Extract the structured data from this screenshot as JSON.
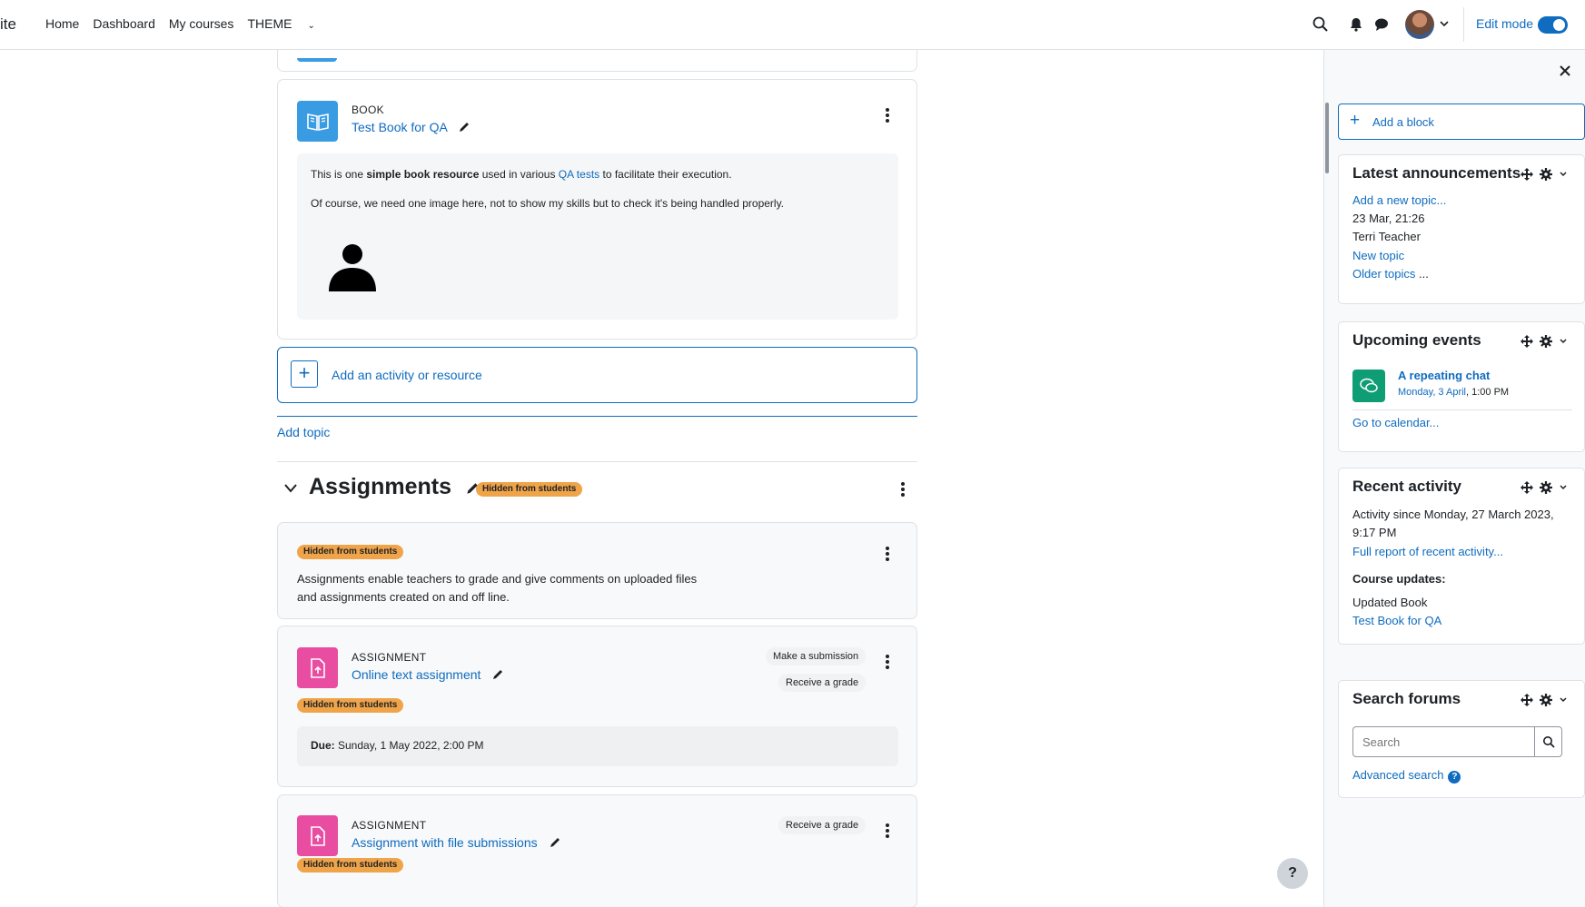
{
  "navbar": {
    "site_name": "ite",
    "links": [
      "Home",
      "Dashboard",
      "My courses",
      "THEME"
    ],
    "edit_mode_label": "Edit mode"
  },
  "book": {
    "type": "BOOK",
    "name": "Test Book for QA",
    "desc_before": "This is one ",
    "desc_bold": "simple book resource",
    "desc_middle": " used in various ",
    "desc_link": "QA tests",
    "desc_after": " to facilitate their execution.",
    "desc_line2": "Of course, we need one image here, not to show my skills but to check it's being handled properly."
  },
  "add_activity_label": "Add an activity or resource",
  "add_topic_label": "Add topic",
  "section": {
    "title": "Assignments",
    "badge": "Hidden from students",
    "summary_badge": "Hidden from students",
    "summary_line1": "Assignments enable teachers to grade and give comments on uploaded files",
    "summary_line2": "and assignments created on and off line."
  },
  "assignment1": {
    "type": "ASSIGNMENT",
    "name": "Online text assignment",
    "badge": "Hidden from students",
    "completion1": "Make a submission",
    "completion2": "Receive a grade",
    "due_label": "Due:",
    "due_value": " Sunday, 1 May 2022, 2:00 PM"
  },
  "assignment2": {
    "type": "ASSIGNMENT",
    "name": "Assignment with file submissions",
    "badge": "Hidden from students",
    "completion1": "Receive a grade"
  },
  "help_label": "?",
  "drawer": {
    "add_block_label": "Add a block",
    "announcements": {
      "title": "Latest announcements",
      "add_topic": "Add a new topic...",
      "date": "23 Mar, 21:26",
      "author": "Terri Teacher",
      "topic": "New topic",
      "older_link": "Older topics",
      "older_suffix": " ..."
    },
    "events": {
      "title": "Upcoming events",
      "event_name": "A repeating chat",
      "event_date_link": "Monday, 3 April",
      "event_time": ", 1:00 PM",
      "calendar_link": "Go to calendar..."
    },
    "recent": {
      "title": "Recent activity",
      "since_line1": "Activity since Monday, 27 March 2023,",
      "since_line2": "9:17 PM",
      "full_report": "Full report of recent activity...",
      "updates_heading": "Course updates:",
      "updated_text": "Updated Book",
      "updated_link": "Test Book for QA"
    },
    "search_forums": {
      "title": "Search forums",
      "placeholder": "Search",
      "advanced": "Advanced search"
    }
  },
  "colors": {
    "brand": "#0f6cbf",
    "book_icon": "#399be2",
    "assignment_icon": "#e84da1",
    "event_icon": "#0f9d75",
    "hidden_badge": "#f0a44a"
  }
}
